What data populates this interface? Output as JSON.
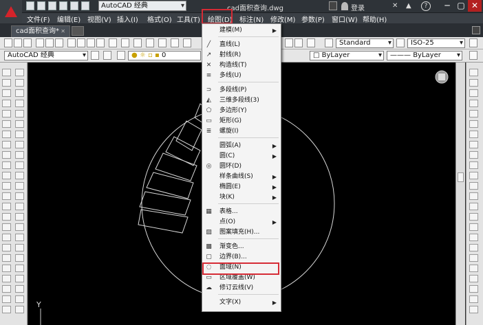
{
  "app": {
    "workspace": "AutoCAD 经典",
    "doc_title": "cad面积查询.dwg",
    "login": "登录",
    "help_glyph": "?",
    "window_controls": [
      "─",
      "▢",
      "✕"
    ]
  },
  "menubar": [
    "文件(F)",
    "编辑(E)",
    "视图(V)",
    "插入(I)",
    "格式(O)",
    "工具(T)",
    "绘图(D)",
    "标注(N)",
    "修改(M)",
    "参数(P)",
    "窗口(W)",
    "帮助(H)"
  ],
  "tab": {
    "label": "cad面积查询*",
    "close": "✕"
  },
  "toolbar": {
    "text_style": "Standard",
    "dim_style": "ISO-25",
    "workspace2": "AutoCAD 经典",
    "layer": "0",
    "color": "ByLayer",
    "linetype": "ByLayer"
  },
  "draw_menu": [
    {
      "label": "建模(M)",
      "sub": true,
      "icon": ""
    },
    {
      "label": "直线(L)",
      "icon": "line-icon",
      "glyph": "╱"
    },
    {
      "label": "射线(R)",
      "icon": "ray-icon",
      "glyph": "↗"
    },
    {
      "label": "构造线(T)",
      "icon": "xline-icon",
      "glyph": "✕"
    },
    {
      "label": "多线(U)",
      "icon": "mline-icon",
      "glyph": "≡"
    },
    {
      "label": "多段线(P)",
      "icon": "pline-icon",
      "glyph": "⊃"
    },
    {
      "label": "三维多段线(3)",
      "icon": "3dpoly-icon",
      "glyph": "◭"
    },
    {
      "label": "多边形(Y)",
      "icon": "polygon-icon",
      "glyph": "⬠"
    },
    {
      "label": "矩形(G)",
      "icon": "rectangle-icon",
      "glyph": "▭"
    },
    {
      "label": "螺旋(I)",
      "icon": "helix-icon",
      "glyph": "≣"
    },
    {
      "label": "圆弧(A)",
      "sub": true,
      "icon": ""
    },
    {
      "label": "圆(C)",
      "sub": true,
      "icon": ""
    },
    {
      "label": "圆环(D)",
      "icon": "donut-icon",
      "glyph": "◎"
    },
    {
      "label": "样条曲线(S)",
      "sub": true,
      "icon": ""
    },
    {
      "label": "椭圆(E)",
      "sub": true,
      "icon": ""
    },
    {
      "label": "块(K)",
      "sub": true,
      "icon": ""
    },
    {
      "label": "表格...",
      "icon": "table-icon",
      "glyph": "▦"
    },
    {
      "label": "点(O)",
      "sub": true,
      "icon": ""
    },
    {
      "label": "图案填充(H)...",
      "icon": "hatch-icon",
      "glyph": "▨"
    },
    {
      "label": "渐变色...",
      "icon": "gradient-icon",
      "glyph": "▩"
    },
    {
      "label": "边界(B)...",
      "icon": "boundary-icon",
      "glyph": "▢"
    },
    {
      "label": "面域(N)",
      "icon": "region-icon",
      "glyph": "◌"
    },
    {
      "label": "区域覆盖(W)",
      "icon": "wipeout-icon",
      "glyph": "▭"
    },
    {
      "label": "修订云线(V)",
      "icon": "revcloud-icon",
      "glyph": "☁"
    },
    {
      "label": "文字(X)",
      "sub": true,
      "icon": ""
    }
  ],
  "canvas": {
    "ucs_y": "Y"
  }
}
